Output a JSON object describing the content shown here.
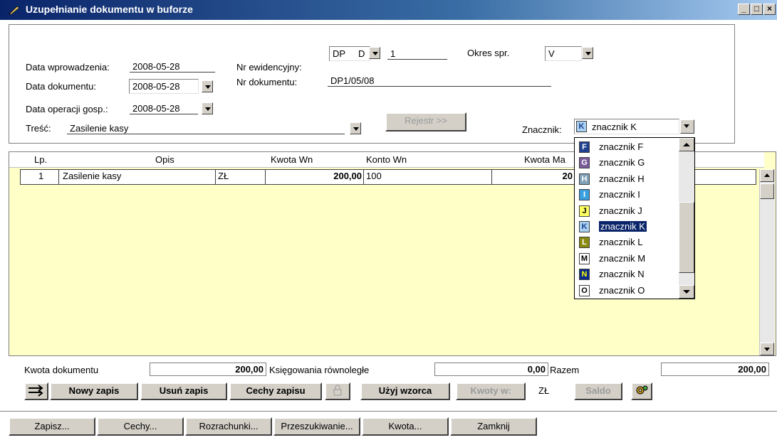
{
  "window": {
    "title": "Uzupełnianie dokumentu w buforze",
    "controls": [
      "_",
      "□",
      "×"
    ]
  },
  "header": {
    "data_wprowadzenia_label": "Data wprowadzenia:",
    "data_wprowadzenia_value": "2008-05-28",
    "data_dokumentu_label": "Data dokumentu:",
    "data_dokumentu_value": "2008-05-28",
    "data_operacji_label": "Data operacji gosp.:",
    "data_operacji_value": "2008-05-28",
    "tresc_label": "Treść:",
    "tresc_value": "Zasilenie kasy",
    "nr_ewidencyjny_label": "Nr ewidencyjny:",
    "nr_ewidencyjny_type": "DP",
    "nr_ewidencyjny_sub": "D",
    "nr_ewidencyjny_number": "1",
    "nr_dokumentu_label": "Nr dokumentu:",
    "nr_dokumentu_value": "DP1/05/08",
    "okres_label": "Okres spr.",
    "okres_value": "V",
    "rejestr_button": "Rejestr >>",
    "znacznik_label": "Znacznik:",
    "znacznik_value": "znacznik K",
    "znacznik_badge": "K"
  },
  "grid": {
    "columns": [
      "Lp.",
      "Opis",
      "Kwota Wn",
      "Konto Wn",
      "Kwota Ma"
    ],
    "rows": [
      {
        "lp": "1",
        "opis": "Zasilenie kasy",
        "waluta": "ZŁ",
        "kwota_wn": "200,00",
        "konto_wn": "100",
        "kwota_ma": "20"
      }
    ]
  },
  "summary": {
    "kwota_dokumentu_label": "Kwota dokumentu",
    "kwota_dokumentu_value": "200,00",
    "ksiegowania_label": "Księgowania równoległe",
    "ksiegowania_value": "0,00",
    "razem_label": "Razem",
    "razem_value": "200,00"
  },
  "toolbar": {
    "nowy_zapis": "Nowy zapis",
    "usun_zapis": "Usuń zapis",
    "cechy_zapisu": "Cechy zapisu",
    "uzyj_wzorca": "Użyj wzorca",
    "kwoty_w": "Kwoty w:",
    "waluta": "ZŁ",
    "saldo": "Saldo"
  },
  "bottom_buttons": {
    "zapisz": "Zapisz...",
    "cechy": "Cechy...",
    "rozrachunki": "Rozrachunki...",
    "przeszukiwanie": "Przeszukiwanie...",
    "kwota": "Kwota...",
    "zamknij": "Zamknij"
  },
  "dropdown": {
    "items": [
      {
        "badge": "F",
        "label": "znacznik F",
        "bg": "#1f3f8f",
        "fg": "#ffffff"
      },
      {
        "badge": "G",
        "label": "znacznik G",
        "bg": "#7a5a9a",
        "fg": "#ffffff"
      },
      {
        "badge": "H",
        "label": "znacznik H",
        "bg": "#7fa0b8",
        "fg": "#ffffff"
      },
      {
        "badge": "I",
        "label": "znacznik I",
        "bg": "#39a0e0",
        "fg": "#ffffff"
      },
      {
        "badge": "J",
        "label": "znacznik J",
        "bg": "#ffff60",
        "fg": "#000000"
      },
      {
        "badge": "K",
        "label": "znacznik K",
        "bg": "#a8d0f0",
        "fg": "#1f3f8f"
      },
      {
        "badge": "L",
        "label": "znacznik L",
        "bg": "#8a8a10",
        "fg": "#ffffff"
      },
      {
        "badge": "M",
        "label": "znacznik M",
        "bg": "#ffffff",
        "fg": "#000000"
      },
      {
        "badge": "N",
        "label": "znacznik N",
        "bg": "#0a2a8a",
        "fg": "#ffff00"
      },
      {
        "badge": "O",
        "label": "znacznik O",
        "bg": "#ffffff",
        "fg": "#000000"
      }
    ],
    "selected_index": 5
  }
}
